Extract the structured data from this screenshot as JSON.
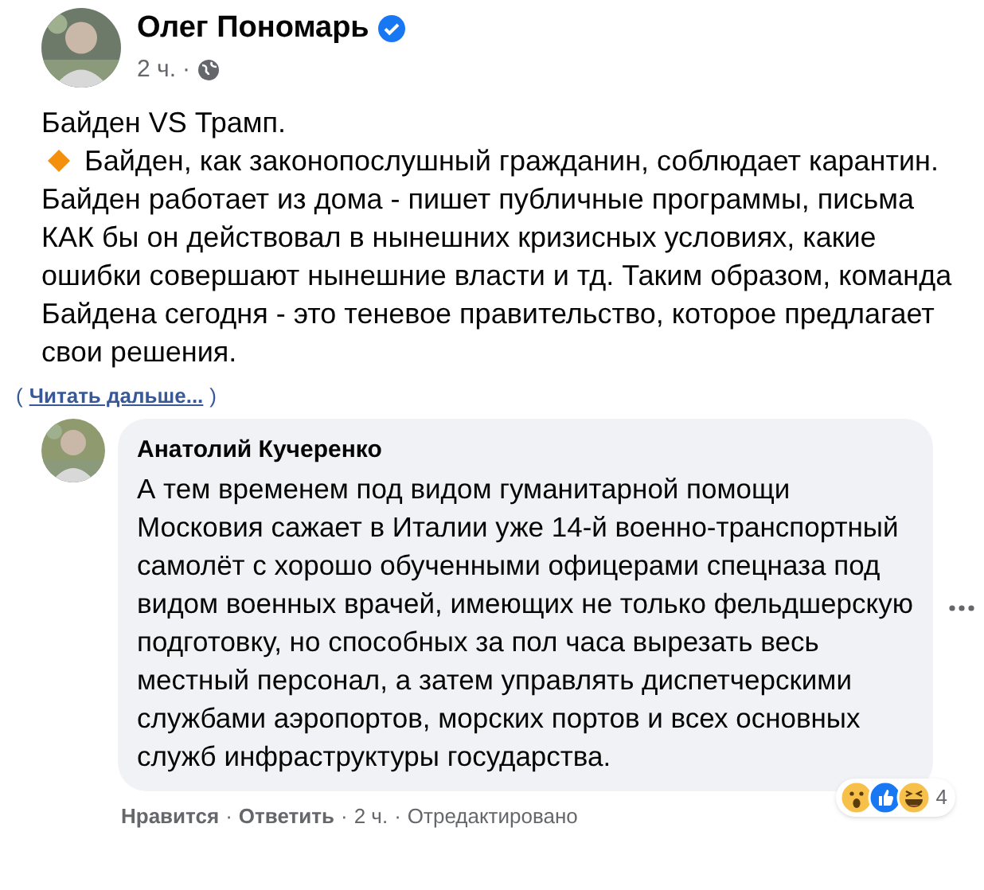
{
  "post": {
    "author": "Олег Пономарь",
    "verified": true,
    "time": "2 ч.",
    "separator": "·",
    "title": "Байден VS Трамп.",
    "body": "Байден, как законопослушный гражданин, соблюдает карантин. Байден работает из дома - пишет публичные программы, письма КАК бы он действовал в нынешних кризисных условиях, какие ошибки совершают нынешние власти и тд. Таким образом,  команда Байдена сегодня - это теневое правительство, которое предлагает свои решения.",
    "read_more": {
      "open": "(",
      "link": "Читать дальше...",
      "close": ")"
    }
  },
  "comment": {
    "author": "Анатолий Кучеренко",
    "text": "А тем временем под видом гуманитарной помощи Московия сажает в Италии уже 14-й военно-транспортный самолёт с хорошо обученными офицерами спецназа под видом военных врачей, имеющих не только фельдшерскую подготовку, но способных за пол часа вырезать весь местный персонал, а затем управлять диспетчерскими службами аэропортов, морских портов и всех основных служб инфраструктуры государства.",
    "actions": [
      {
        "kind": "link",
        "label": "Нравится"
      },
      {
        "kind": "link",
        "label": "Ответить"
      },
      {
        "kind": "meta",
        "label": "2 ч."
      },
      {
        "kind": "meta",
        "label": "Отредактировано"
      }
    ],
    "separator": "·",
    "reactions": {
      "items": [
        {
          "kind": "wow"
        },
        {
          "kind": "like"
        },
        {
          "kind": "haha"
        }
      ],
      "count": "4"
    }
  }
}
